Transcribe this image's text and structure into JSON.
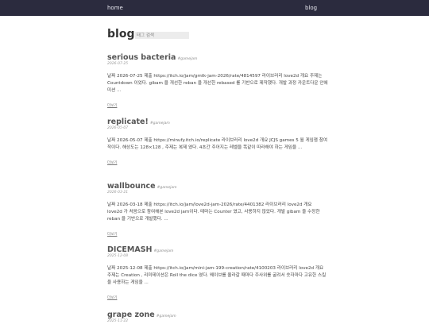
{
  "nav": {
    "home_label": "home",
    "blog_label": "blog"
  },
  "header": {
    "title": "blog",
    "search_placeholder": "태그 검색"
  },
  "posts": [
    {
      "title": "serious bacteria",
      "tag": "#gamejam",
      "date": "2026-07-25",
      "excerpt": "날짜 2026-07-25 제출 https://itch.io/jam/gmtk-jam-2026/rate/4814597 라이브러리 love2d 개요 주제는 Countdown 이었다. gibam 을 개선한 reban 을 개선한 rebased 를 기반으로 제작했다. 개발 과정 카운트다운 안에 미션 ...",
      "more": "더보기"
    },
    {
      "title": "replicate!",
      "tag": "#gamejam",
      "date": "2026-05-07",
      "excerpt": "날짜 2026-05-07 제출 https://minufy.itch.io/replicate 라이브러리 love2d 개요 JCJS games 5 월 게임잼 참여작이다. 해상도는 128×128 , 주제는 복제 였다. 4초간 주어지는 레벨을 똑같이 따라해야 하는 게임을 ...",
      "more": "더보기"
    },
    {
      "title": "wallbounce",
      "tag": "#gamejam",
      "date": "2026-03-21",
      "excerpt": "날짜 2026-03-18 제출 https://itch.io/jam/love2d-jam-2026/rate/4401382 라이브러리 love2d 개요 love2d 가 처음으로 참여해본 love2d jam이다. 테마는 Counter 였고, 사용하지 않았다. 개발 gibam 을 수정한 reban 을 기반으로 개발했다. ...",
      "more": "더보기"
    },
    {
      "title": "DICEMASH",
      "tag": "#gamejam",
      "date": "2025-12-08",
      "excerpt": "날짜 2025-12-08 제출 https://itch.io/jam/mini-jam-199-creation/rate/4100203 라이브러리 love2d 개요 주제는 Creation , 리미테이션은 Roll the dice 였다. 웨이브를 올라갈 때마다 주사위를 굴려서 숫자마다 고유한 스킬을 사용하는 게임을 ...",
      "more": "더보기"
    },
    {
      "title": "grape zone",
      "tag": "#gamejam",
      "date": "2025-11-22",
      "excerpt": "",
      "more": ""
    }
  ]
}
